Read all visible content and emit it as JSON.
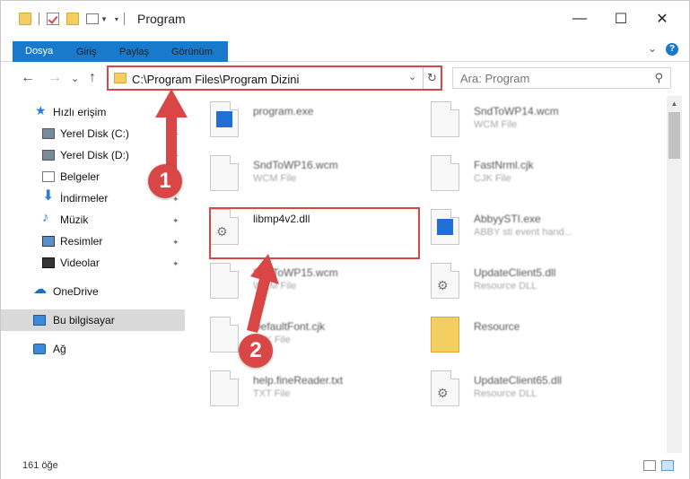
{
  "window": {
    "title": "Program",
    "minimize_glyph": "—",
    "maximize_glyph": "☐",
    "close_glyph": "✕"
  },
  "ribbon": {
    "tabs": [
      {
        "label": "Dosya"
      },
      {
        "label": "Giriş"
      },
      {
        "label": "Paylaş"
      },
      {
        "label": "Görünüm"
      }
    ],
    "help_glyph": "?",
    "expand_glyph": "⌄"
  },
  "navigation": {
    "back_glyph": "←",
    "forward_glyph": "→",
    "recent_glyph": "⌄",
    "up_glyph": "↑",
    "address": "C:\\Program Files\\Program Dizini",
    "address_dropdown_glyph": "⌄",
    "refresh_glyph": "↻",
    "search_placeholder": "Ara: Program",
    "search_icon": "magnifier-icon",
    "search_glyph": "⚲"
  },
  "sidebar": {
    "quick_access": "Hızlı erişim",
    "items": [
      {
        "label": "Yerel Disk (C:)",
        "icon": "disk-icon",
        "pinned": true
      },
      {
        "label": "Yerel Disk (D:)",
        "icon": "disk-icon",
        "pinned": true
      },
      {
        "label": "Belgeler",
        "icon": "documents-icon",
        "pinned": true
      },
      {
        "label": "İndirmeler",
        "icon": "download-icon",
        "pinned": true
      },
      {
        "label": "Müzik",
        "icon": "music-icon",
        "pinned": true
      },
      {
        "label": "Resimler",
        "icon": "pictures-icon",
        "pinned": true
      },
      {
        "label": "Videolar",
        "icon": "videos-icon",
        "pinned": true
      }
    ],
    "pin_glyph": "✦",
    "star_glyph": "★",
    "download_glyph": "⬇",
    "music_glyph": "♪",
    "cloud_glyph": "☁",
    "onedrive": "OneDrive",
    "this_pc": "Bu bilgisayar",
    "network": "Ağ"
  },
  "files": {
    "left": [
      {
        "name": "program.exe",
        "type": ""
      },
      {
        "name": "SndToWP16.wcm",
        "type": "WCM File"
      },
      {
        "name": "libmp4v2.dll",
        "type": ""
      },
      {
        "name": "SndToWP15.wcm",
        "type": "WCM File"
      },
      {
        "name": "DefaultFont.cjk",
        "type": "CJK File"
      },
      {
        "name": "help.fineReader.txt",
        "type": "TXT File"
      }
    ],
    "right": [
      {
        "name": "SndToWP14.wcm",
        "type": "WCM File"
      },
      {
        "name": "FastNrml.cjk",
        "type": "CJK File"
      },
      {
        "name": "AbbyySTI.exe",
        "type": "ABBY sti event hand..."
      },
      {
        "name": "UpdateClient5.dll",
        "type": "Resource DLL"
      },
      {
        "name": "Resource",
        "type": ""
      },
      {
        "name": "UpdateClient65.dll",
        "type": "Resource DLL"
      }
    ],
    "gear_glyph": "⚙"
  },
  "status": {
    "count": "161 öğe"
  },
  "annotations": {
    "step1": "1",
    "step2": "2",
    "color": "#d94646"
  },
  "colors": {
    "accent": "#1979ca",
    "highlight": "#d94646",
    "selected_nav": "#d9d9d9",
    "folder": "#f3cf61"
  }
}
